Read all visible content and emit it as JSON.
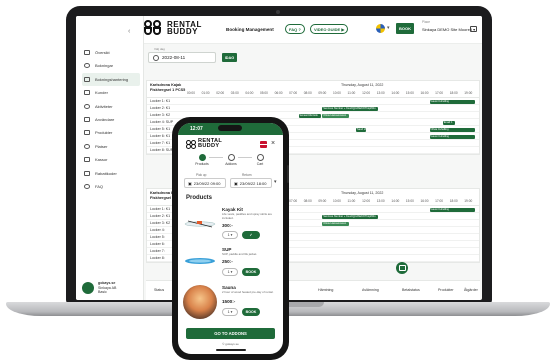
{
  "brand": {
    "line1": "RENTAL",
    "line2": "BUDDY"
  },
  "topbar": {
    "section": "Booking Management",
    "faq_label": "FAQ",
    "video_label": "VIDEO GUIDE",
    "book_label": "BOOK",
    "place_label": "Place",
    "place_value": "Sinkaya DEMO Site Moored"
  },
  "sidebar": {
    "items": [
      {
        "label": "Översikt",
        "icon": "grid-icon"
      },
      {
        "label": "Bokningar",
        "icon": "cart-icon"
      },
      {
        "label": "Bokningshantering",
        "icon": "calendar-icon",
        "active": true
      },
      {
        "label": "Kunder",
        "icon": "person-icon"
      },
      {
        "label": "Aktiviteter",
        "icon": "list-icon"
      },
      {
        "label": "Användare",
        "icon": "users-icon"
      },
      {
        "label": "Produkter",
        "icon": "tag-icon"
      },
      {
        "label": "Platser",
        "icon": "pin-icon"
      },
      {
        "label": "Kassor",
        "icon": "box-icon"
      },
      {
        "label": "Rabattkoder",
        "icon": "ticket-icon"
      },
      {
        "label": "FAQ",
        "icon": "question-icon"
      }
    ],
    "user": {
      "name": "gokays.se",
      "sub1": "Sinkaya AB",
      "sub2": "Basic"
    }
  },
  "date_picker": {
    "label": "Välj dag",
    "value": "2022-08-11",
    "today_label": "IDAG"
  },
  "hours": [
    "00:00",
    "01:00",
    "02:00",
    "03:00",
    "04:00",
    "05:00",
    "06:00",
    "07:00",
    "08:00",
    "09:00",
    "10:00",
    "11:00",
    "12:00",
    "13:00",
    "14:00",
    "15:00",
    "16:00",
    "17:00",
    "18:00",
    "19:00"
  ],
  "grid1": {
    "title1": "Karlsdrona Kajak",
    "title2": "Fiskhergsel 1 PCS5",
    "date": "Thursday, August 11, 2022",
    "rows": [
      "Locker 1: K1",
      "Locker 2: K1",
      "Locker 3: K2",
      "Locker 4: SUP",
      "Locker 5: K1",
      "Locker 6: K1",
      "Locker 7: K1",
      "Locker 8: SUP"
    ],
    "bars": [
      {
        "row": 0,
        "start": 16.5,
        "end": 19.6,
        "text": "Gaust Cuhelling",
        "tone": "dark"
      },
      {
        "row": 1,
        "start": 9.2,
        "end": 13.0,
        "text": "Services Number + Ksu2QjCdhEKNThtq29bn",
        "tone": "dark"
      },
      {
        "row": 2,
        "start": 7.6,
        "end": 9.1,
        "text": "lamasr/Afertsok",
        "tone": "dark"
      },
      {
        "row": 2,
        "start": 9.2,
        "end": 11.0,
        "text": "Olivia Hanssonsson",
        "tone": "light"
      },
      {
        "row": 3,
        "start": 17.4,
        "end": 18.2,
        "text": "Email 1",
        "tone": "dark"
      },
      {
        "row": 4,
        "start": 11.5,
        "end": 12.2,
        "text": "Sand Hy",
        "tone": "dark"
      },
      {
        "row": 4,
        "start": 16.5,
        "end": 19.6,
        "text": "Olivia Cuhelling",
        "tone": "dark"
      },
      {
        "row": 5,
        "start": 16.5,
        "end": 19.6,
        "text": "Gaust Cuhelling",
        "tone": "dark"
      }
    ]
  },
  "grid2": {
    "title1": "Karlsdrona Kajak",
    "title2": "Fiskhergsel 2 PCS5",
    "date": "Thursday, August 11, 2022",
    "rows": [
      "Locker 1: K1",
      "Locker 2: K1",
      "Locker 3: K2",
      "Locker 4:",
      "Locker 5:",
      "Locker 6:",
      "Locker 7:",
      "Locker 8:"
    ],
    "bars": [
      {
        "row": 0,
        "start": 16.5,
        "end": 19.6,
        "text": "Gaust Cuhelling",
        "tone": "dark"
      },
      {
        "row": 1,
        "start": 9.2,
        "end": 13.0,
        "text": "Services Number + Ksu2QjCdhEKNThtq29bn",
        "tone": "dark"
      },
      {
        "row": 2,
        "start": 9.2,
        "end": 11.0,
        "text": "Olivia Hanssonsson",
        "tone": "light"
      }
    ]
  },
  "table": {
    "headers": [
      "Status",
      "Hämtning",
      "Avlämning",
      "Betalstatus",
      "Produkter",
      "Åtgärder"
    ]
  },
  "phone": {
    "time": "12:07",
    "steps": [
      "Products",
      "Addons",
      "Cart"
    ],
    "cart_count": "0",
    "pickup_label": "Pick up",
    "pickup_value": "23/09/22 09:00",
    "return_label": "Return",
    "return_value": "23/09/22 18:00",
    "products_title": "Products",
    "products": [
      {
        "name": "Kayak Kit",
        "desc": "Life vests, paddles and spray skirts are included.",
        "price": "300:-",
        "qty": "1",
        "action": "✓"
      },
      {
        "name": "SUP",
        "desc": "SUP, paddle and life jacket.",
        "price": "250:-",
        "qty": "1",
        "action": "BOOK"
      },
      {
        "name": "Sauna",
        "desc": "2 hour of wood heated pre-day of rental.",
        "price": "1500:-",
        "qty": "1",
        "action": "BOOK"
      }
    ],
    "cta": "GO TO ADDONS",
    "footer": "© gokays.se"
  },
  "colors": {
    "brand_green": "#1f6b3a",
    "bar_light": "#3a8a55"
  }
}
